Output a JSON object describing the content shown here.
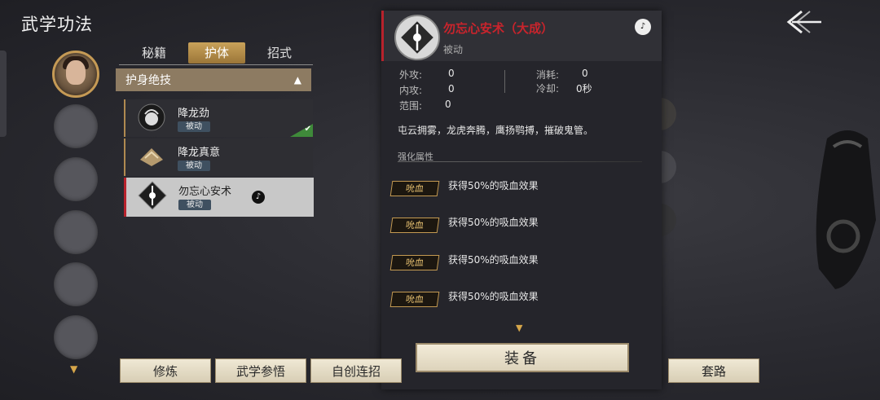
{
  "header": {
    "title": "武学功法"
  },
  "tabs": [
    {
      "label": "秘籍",
      "active": false
    },
    {
      "label": "护体",
      "active": true
    },
    {
      "label": "招式",
      "active": false
    }
  ],
  "section": {
    "title": "护身绝技"
  },
  "skills": [
    {
      "name": "降龙劲",
      "badge": "被动",
      "equipped": true
    },
    {
      "name": "降龙真意",
      "badge": "被动",
      "equipped": false
    },
    {
      "name": "勿忘心安术",
      "badge": "被动",
      "selected": true
    }
  ],
  "detail": {
    "name": "勿忘心安术（大成）",
    "type": "被动",
    "stats": {
      "outer_attack_label": "外攻:",
      "outer_attack": "0",
      "inner_attack_label": "内攻:",
      "inner_attack": "0",
      "range_label": "范围:",
      "range": "0",
      "cost_label": "消耗:",
      "cost": "0",
      "cooldown_label": "冷却:",
      "cooldown": "0秒"
    },
    "description": "屯云拥雾，龙虎奔腾，鹰扬鹗搏，摧破鬼管。",
    "enhance_title": "强化属性",
    "enhancements": [
      {
        "tag": "吮血",
        "text": "获得50%的吸血效果"
      },
      {
        "tag": "吮血",
        "text": "获得50%的吸血效果"
      },
      {
        "tag": "吮血",
        "text": "获得50%的吸血效果"
      },
      {
        "tag": "吮血",
        "text": "获得50%的吸血效果"
      }
    ],
    "equip_label": "装备"
  },
  "bottom_buttons": {
    "train": "修炼",
    "study": "武学参悟",
    "custom_combo": "自创连招",
    "routine": "套路"
  },
  "colors": {
    "accent_gold": "#c9a25a",
    "name_red": "#c9242c"
  }
}
